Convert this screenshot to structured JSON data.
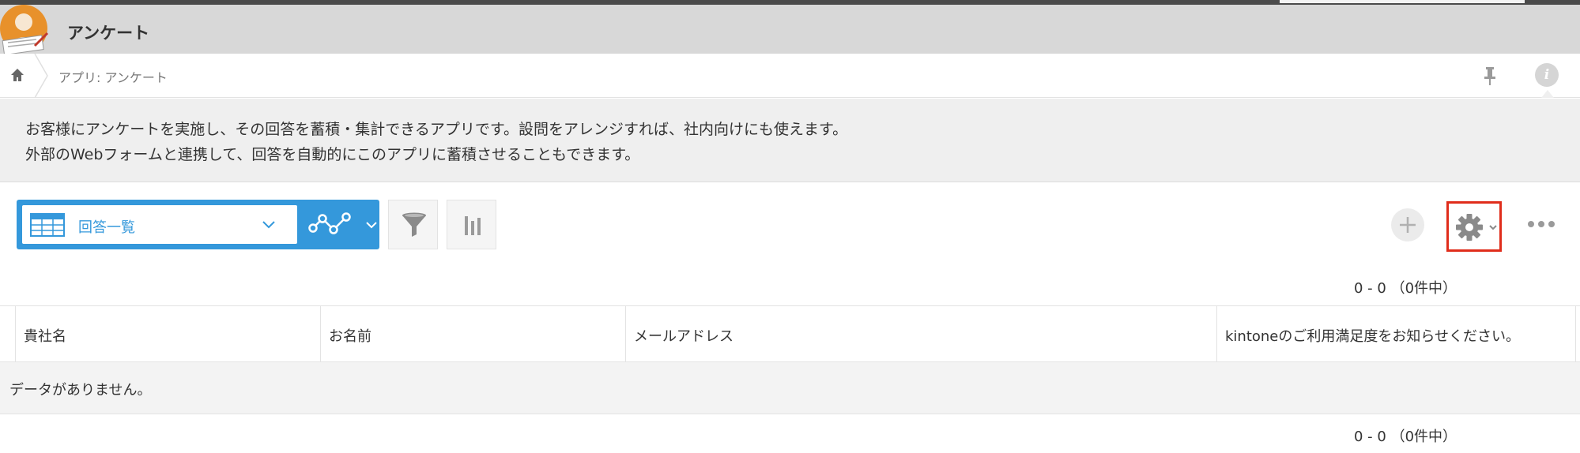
{
  "app": {
    "title": "アンケート",
    "icon": "survey-person-icon"
  },
  "breadcrumb": {
    "home_icon": "home-icon",
    "path": "アプリ: アンケート"
  },
  "header_actions": {
    "pin_icon": "pin-icon",
    "info_label": "i"
  },
  "description": {
    "line1": "お客様にアンケートを実施し、その回答を蓄積・集計できるアプリです。設問をアレンジすれば、社内向けにも使えます。",
    "line2": "外部のWebフォームと連携して、回答を自動的にこのアプリに蓄積させることもできます。"
  },
  "toolbar": {
    "view_name": "回答一覧",
    "view_icon": "table-icon",
    "graph_icon": "graph-icon",
    "filter_icon": "filter-icon",
    "chart_icon": "bar-chart-icon",
    "add_icon": "plus-icon",
    "settings_icon": "gear-icon",
    "more_icon": "more-dots-icon",
    "accent_color": "#3498db",
    "highlight_color": "#e02d1b"
  },
  "pagination": {
    "top": "0 - 0 （0件中）",
    "bottom": "0 - 0 （0件中）"
  },
  "table": {
    "columns": [
      "貴社名",
      "お名前",
      "メールアドレス",
      "kintoneのご利用満足度をお知らせください。"
    ],
    "empty_message": "データがありません。"
  }
}
